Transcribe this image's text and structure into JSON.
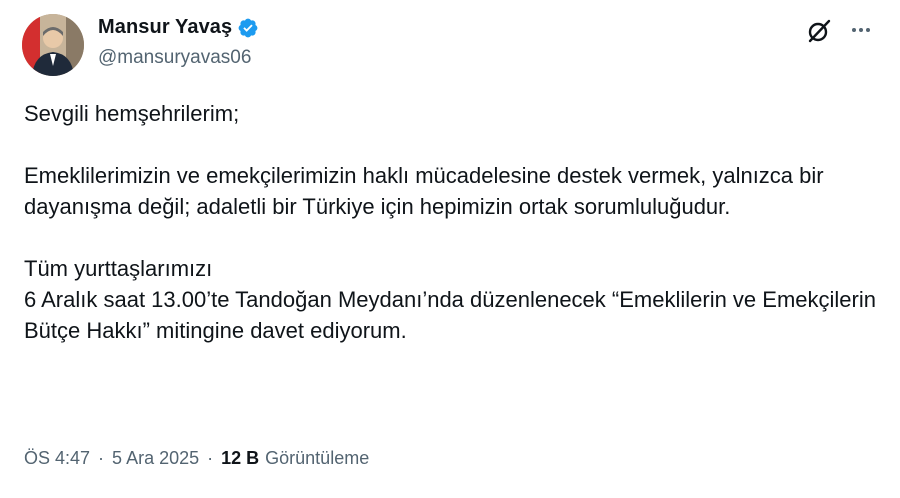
{
  "author": {
    "display_name": "Mansur Yavaş",
    "handle": "@mansuryavas06",
    "verified_color": "#1d9bf0"
  },
  "icons": {
    "avatar": "profile-photo",
    "verified": "verified-badge-icon",
    "grok": "grok-icon",
    "more": "more-dots-icon"
  },
  "tweet": {
    "text": "Sevgili hemşehrilerim;\n\nEmeklilerimizin ve emekçilerimizin haklı mücadelesine destek vermek, yalnızca bir dayanışma değil; adaletli bir Türkiye için hepimizin ortak sorumluluğudur.\n\nTüm yurttaşlarımızı\n6 Aralık saat 13.00’te Tandoğan Meydanı’nda düzenlenecek “Emeklilerin ve Emekçilerin Bütçe Hakkı” mitingine davet ediyorum."
  },
  "meta": {
    "time": "ÖS 4:47",
    "separator": "·",
    "date": "5 Ara 2025",
    "views_count": "12 B",
    "views_label": "Görüntüleme"
  }
}
